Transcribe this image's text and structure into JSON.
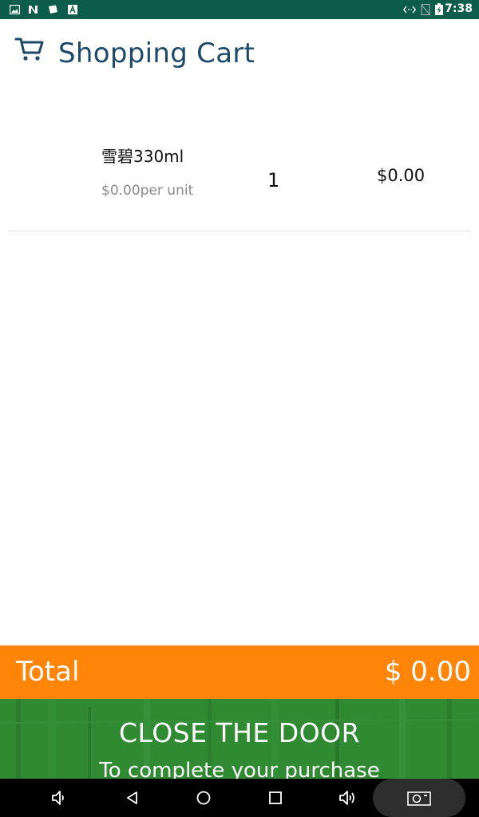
{
  "status_bar": {
    "time": "7:38",
    "left_icons": [
      "image-icon",
      "n-app-icon",
      "note-icon",
      "a-app-icon"
    ],
    "right_icons": [
      "code-arrows-icon",
      "no-sim-icon",
      "battery-charging-icon"
    ],
    "background_color": "#0d5d4d"
  },
  "header": {
    "title": "Shopping Cart",
    "icon": "cart-icon",
    "title_color": "#1e4a6a"
  },
  "cart": {
    "items": [
      {
        "name": "雪碧330ml",
        "unit_price": "$0.00per unit",
        "quantity": "1",
        "price": "$0.00"
      }
    ]
  },
  "total": {
    "label": "Total",
    "amount": "$ 0.00",
    "background_color": "#ff8509"
  },
  "door_banner": {
    "title": "CLOSE THE DOOR",
    "subtitle": "To complete your purchase",
    "background_color": "#2f8a32"
  },
  "nav_bar": {
    "buttons": [
      "volume-down-icon",
      "back-icon",
      "home-icon",
      "recents-icon",
      "volume-up-icon",
      "screenshot-icon"
    ]
  }
}
